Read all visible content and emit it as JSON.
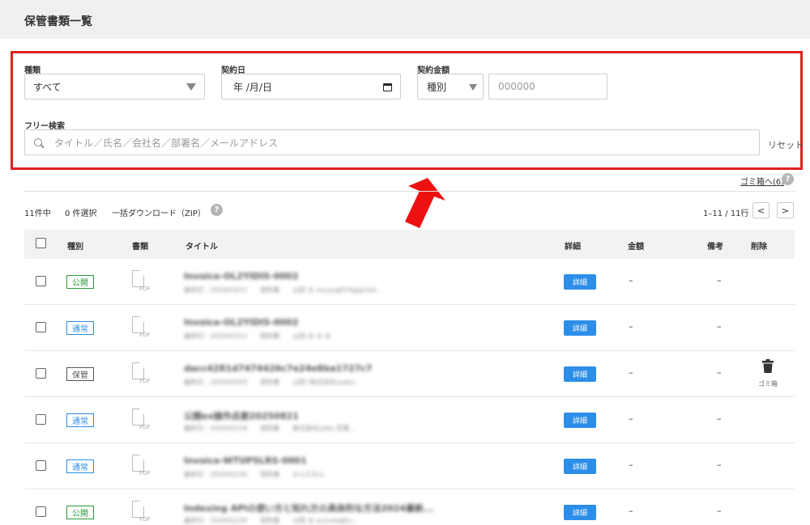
{
  "header": {
    "title": "保管書類一覧"
  },
  "filters": {
    "kind": {
      "label": "種類",
      "value": "すべて"
    },
    "date": {
      "label": "契約日",
      "value": "年 /月/日"
    },
    "amount": {
      "label": "契約金額",
      "type_value": "種別",
      "amount_placeholder": "000000"
    },
    "search": {
      "label": "フリー検索",
      "placeholder": "タイトル／氏名／会社名／部署名／メールアドレス"
    },
    "reset_label": "リセット"
  },
  "trash_link": "ゴミ箱へ(6)",
  "help_symbol": "?",
  "toolbar": {
    "total": "11件中",
    "selected": "0 件選択",
    "bulk_download": "一括ダウンロード（ZIP）",
    "range": "1–11 / 11行",
    "prev": "<",
    "next": ">"
  },
  "table": {
    "headers": {
      "kind": "種別",
      "doc": "書類",
      "title": "タイトル",
      "detail": "詳細",
      "amount": "金額",
      "note": "備考",
      "delete": "削除"
    },
    "pdf_label": "PDF",
    "detail_label": "詳細",
    "dash": "–",
    "trash_label": "ゴミ箱",
    "rows": [
      {
        "tag": "公開",
        "tag_color": "#2a9a3a",
        "title": "Invoice-OL2YIDIS-0002",
        "meta": "最終日：2026/03/12　　契約書　　山田 太 xxyyyg014@gmail..."
      },
      {
        "tag": "通常",
        "tag_color": "#2c8ee8",
        "title": "Invoice-OL2YIDIS-0002",
        "meta": "最終日：2026/03/12　　契約書　　山田 太 太 太"
      },
      {
        "tag": "保管",
        "tag_color": "#555555",
        "title": "dacc4281d7474426c7e24e8ba1727c7",
        "meta": "最終日：2026/03/03　　契約書　　山田 (株式会社)yabu...",
        "trash": true
      },
      {
        "tag": "通常",
        "tag_color": "#2c8ee8",
        "title": "公開ex操作点差20250821",
        "meta": "最終日：2026/02/28　　契約書　　株式会社yabu 営業..."
      },
      {
        "tag": "通常",
        "tag_color": "#2c8ee8",
        "title": "Invoice-WTUPSLRS-0001",
        "meta": "最終日：2026/02/26　　契約書　　かんだかん"
      },
      {
        "tag": "公開",
        "tag_color": "#2a9a3a",
        "title": "Indexing APIの使い方と知れ方の具体的な方法2024最新...",
        "meta": "最終日：2026/02/20　　契約書　　山田 太 yusuke@tu..."
      }
    ]
  },
  "colors": {
    "highlight_border": "#e02020",
    "primary": "#2c8ee8"
  }
}
